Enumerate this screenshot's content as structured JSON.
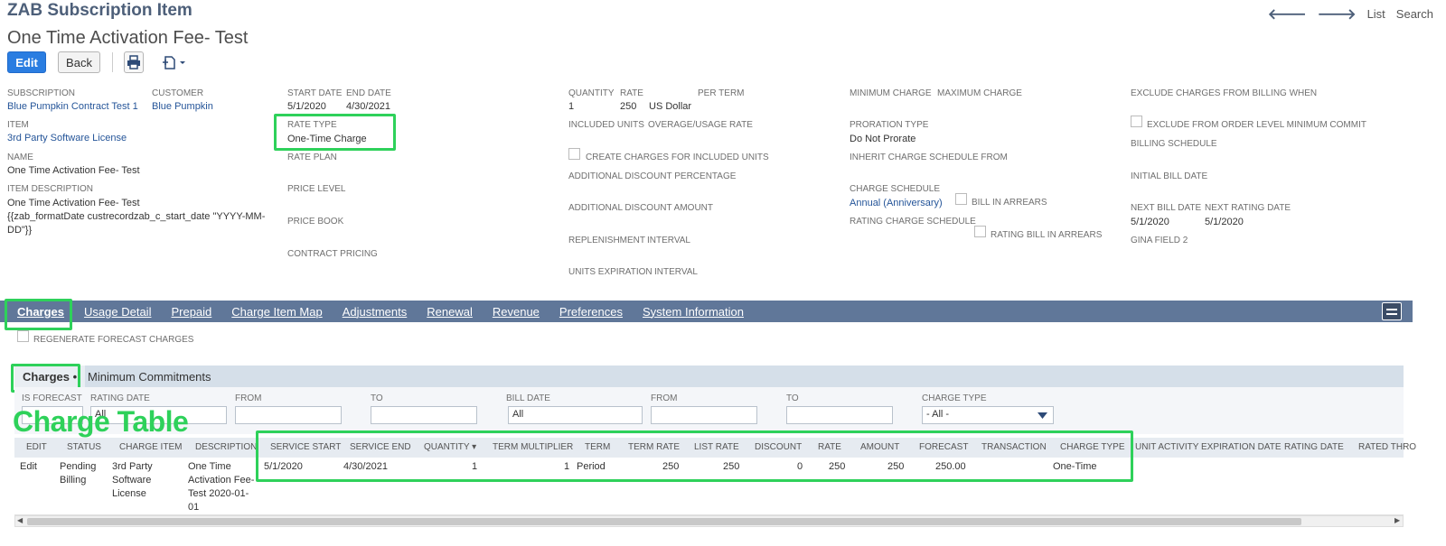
{
  "header": {
    "record_type": "ZAB Subscription Item",
    "record_name": "One Time Activation Fee- Test"
  },
  "topnav": {
    "prev": "🡐",
    "next": "🡒",
    "list": "List",
    "search": "Search"
  },
  "toolbar": {
    "edit": "Edit",
    "back": "Back"
  },
  "fields": {
    "subscription_label": "SUBSCRIPTION",
    "subscription_value": "Blue Pumpkin Contract Test 1",
    "customer_label": "CUSTOMER",
    "customer_value": "Blue Pumpkin",
    "item_label": "ITEM",
    "item_value": "3rd Party Software License",
    "name_label": "NAME",
    "name_value": "One Time Activation Fee- Test",
    "item_desc_label": "ITEM DESCRIPTION",
    "item_desc_line1": "One Time Activation Fee- Test",
    "item_desc_line2": "{{zab_formatDate custrecordzab_c_start_date \"YYYY-MM-",
    "item_desc_line3": "DD\"}}",
    "start_date_label": "START DATE",
    "start_date_value": "5/1/2020",
    "end_date_label": "END DATE",
    "end_date_value": "4/30/2021",
    "rate_type_label": "RATE TYPE",
    "rate_type_value": "One-Time Charge",
    "rate_plan_label": "RATE PLAN",
    "price_level_label": "PRICE LEVEL",
    "price_book_label": "PRICE BOOK",
    "contract_pricing_label": "CONTRACT PRICING",
    "quantity_label": "QUANTITY",
    "quantity_value": "1",
    "rate_label": "RATE",
    "rate_value": "250",
    "currency_value": "US Dollar",
    "per_term_label": "PER TERM",
    "included_units_label": "INCLUDED UNITS",
    "overage_rate_label": "OVERAGE/USAGE RATE",
    "create_charges_label": "CREATE CHARGES FOR INCLUDED UNITS",
    "add_disc_pct_label": "ADDITIONAL DISCOUNT PERCENTAGE",
    "add_disc_amt_label": "ADDITIONAL DISCOUNT AMOUNT",
    "replenishment_label": "REPLENISHMENT",
    "replenishment_interval_label": "INTERVAL",
    "units_exp_label": "UNITS EXPIRATION",
    "units_exp_interval_label": "INTERVAL",
    "min_charge_label": "MINIMUM CHARGE",
    "max_charge_label": "MAXIMUM CHARGE",
    "proration_label": "PRORATION TYPE",
    "proration_value": "Do Not Prorate",
    "inherit_label": "INHERIT CHARGE SCHEDULE FROM",
    "charge_sched_label": "CHARGE SCHEDULE",
    "charge_sched_value": "Annual (Anniversary)",
    "bill_arrears_label": "BILL IN ARREARS",
    "rating_sched_label": "RATING CHARGE SCHEDULE",
    "rating_arrears_label": "RATING BILL IN ARREARS",
    "exclude_when_label": "EXCLUDE CHARGES FROM BILLING WHEN",
    "exclude_order_label": "EXCLUDE FROM ORDER LEVEL MINIMUM COMMIT",
    "billing_sched_label": "BILLING SCHEDULE",
    "initial_bill_label": "INITIAL BILL DATE",
    "next_bill_label": "NEXT BILL DATE",
    "next_bill_value": "5/1/2020",
    "next_rating_label": "NEXT RATING DATE",
    "next_rating_value": "5/1/2020",
    "gina_label": "GINA FIELD 2"
  },
  "tabs": [
    "Charges",
    "Usage Detail",
    "Prepaid",
    "Charge Item Map",
    "Adjustments",
    "Renewal",
    "Revenue",
    "Preferences",
    "System Information"
  ],
  "regenerate_label": "REGENERATE FORECAST CHARGES",
  "subtabs": {
    "charges": "Charges •",
    "min_commit": "Minimum Commitments"
  },
  "filters": {
    "is_forecast": "IS FORECAST",
    "rating_date": "RATING DATE",
    "from1": "FROM",
    "to1": "TO",
    "bill_date": "BILL DATE",
    "bill_date_value": "All",
    "from2": "FROM",
    "to2": "TO",
    "charge_type": "CHARGE TYPE",
    "charge_type_value": "- All -",
    "rating_date_value": "All"
  },
  "annotation": "Charge Table",
  "table": {
    "headers": [
      "EDIT",
      "STATUS",
      "CHARGE ITEM",
      "DESCRIPTION",
      "SERVICE START",
      "SERVICE END",
      "QUANTITY ▾",
      "TERM MULTIPLIER",
      "TERM",
      "TERM RATE",
      "LIST RATE",
      "DISCOUNT",
      "RATE",
      "AMOUNT",
      "FORECAST",
      "TRANSACTION",
      "CHARGE TYPE",
      "UNIT ACTIVITY EXPIRATION DATE",
      "RATING DATE",
      "RATED THRO"
    ],
    "row": {
      "edit": "Edit",
      "status1": "Pending",
      "status2": "Billing",
      "item1": "3rd Party",
      "item2": "Software",
      "item3": "License",
      "desc1": "One Time",
      "desc2": "Activation Fee-",
      "desc3": "Test 2020-01-",
      "desc4": "01",
      "service_start": "5/1/2020",
      "service_end": "4/30/2021",
      "quantity": "1",
      "term_multiplier": "1",
      "term": "Period",
      "term_rate": "250",
      "list_rate": "250",
      "discount": "0",
      "rate": "250",
      "amount": "250",
      "forecast": "250.00",
      "charge_type": "One-Time"
    }
  }
}
